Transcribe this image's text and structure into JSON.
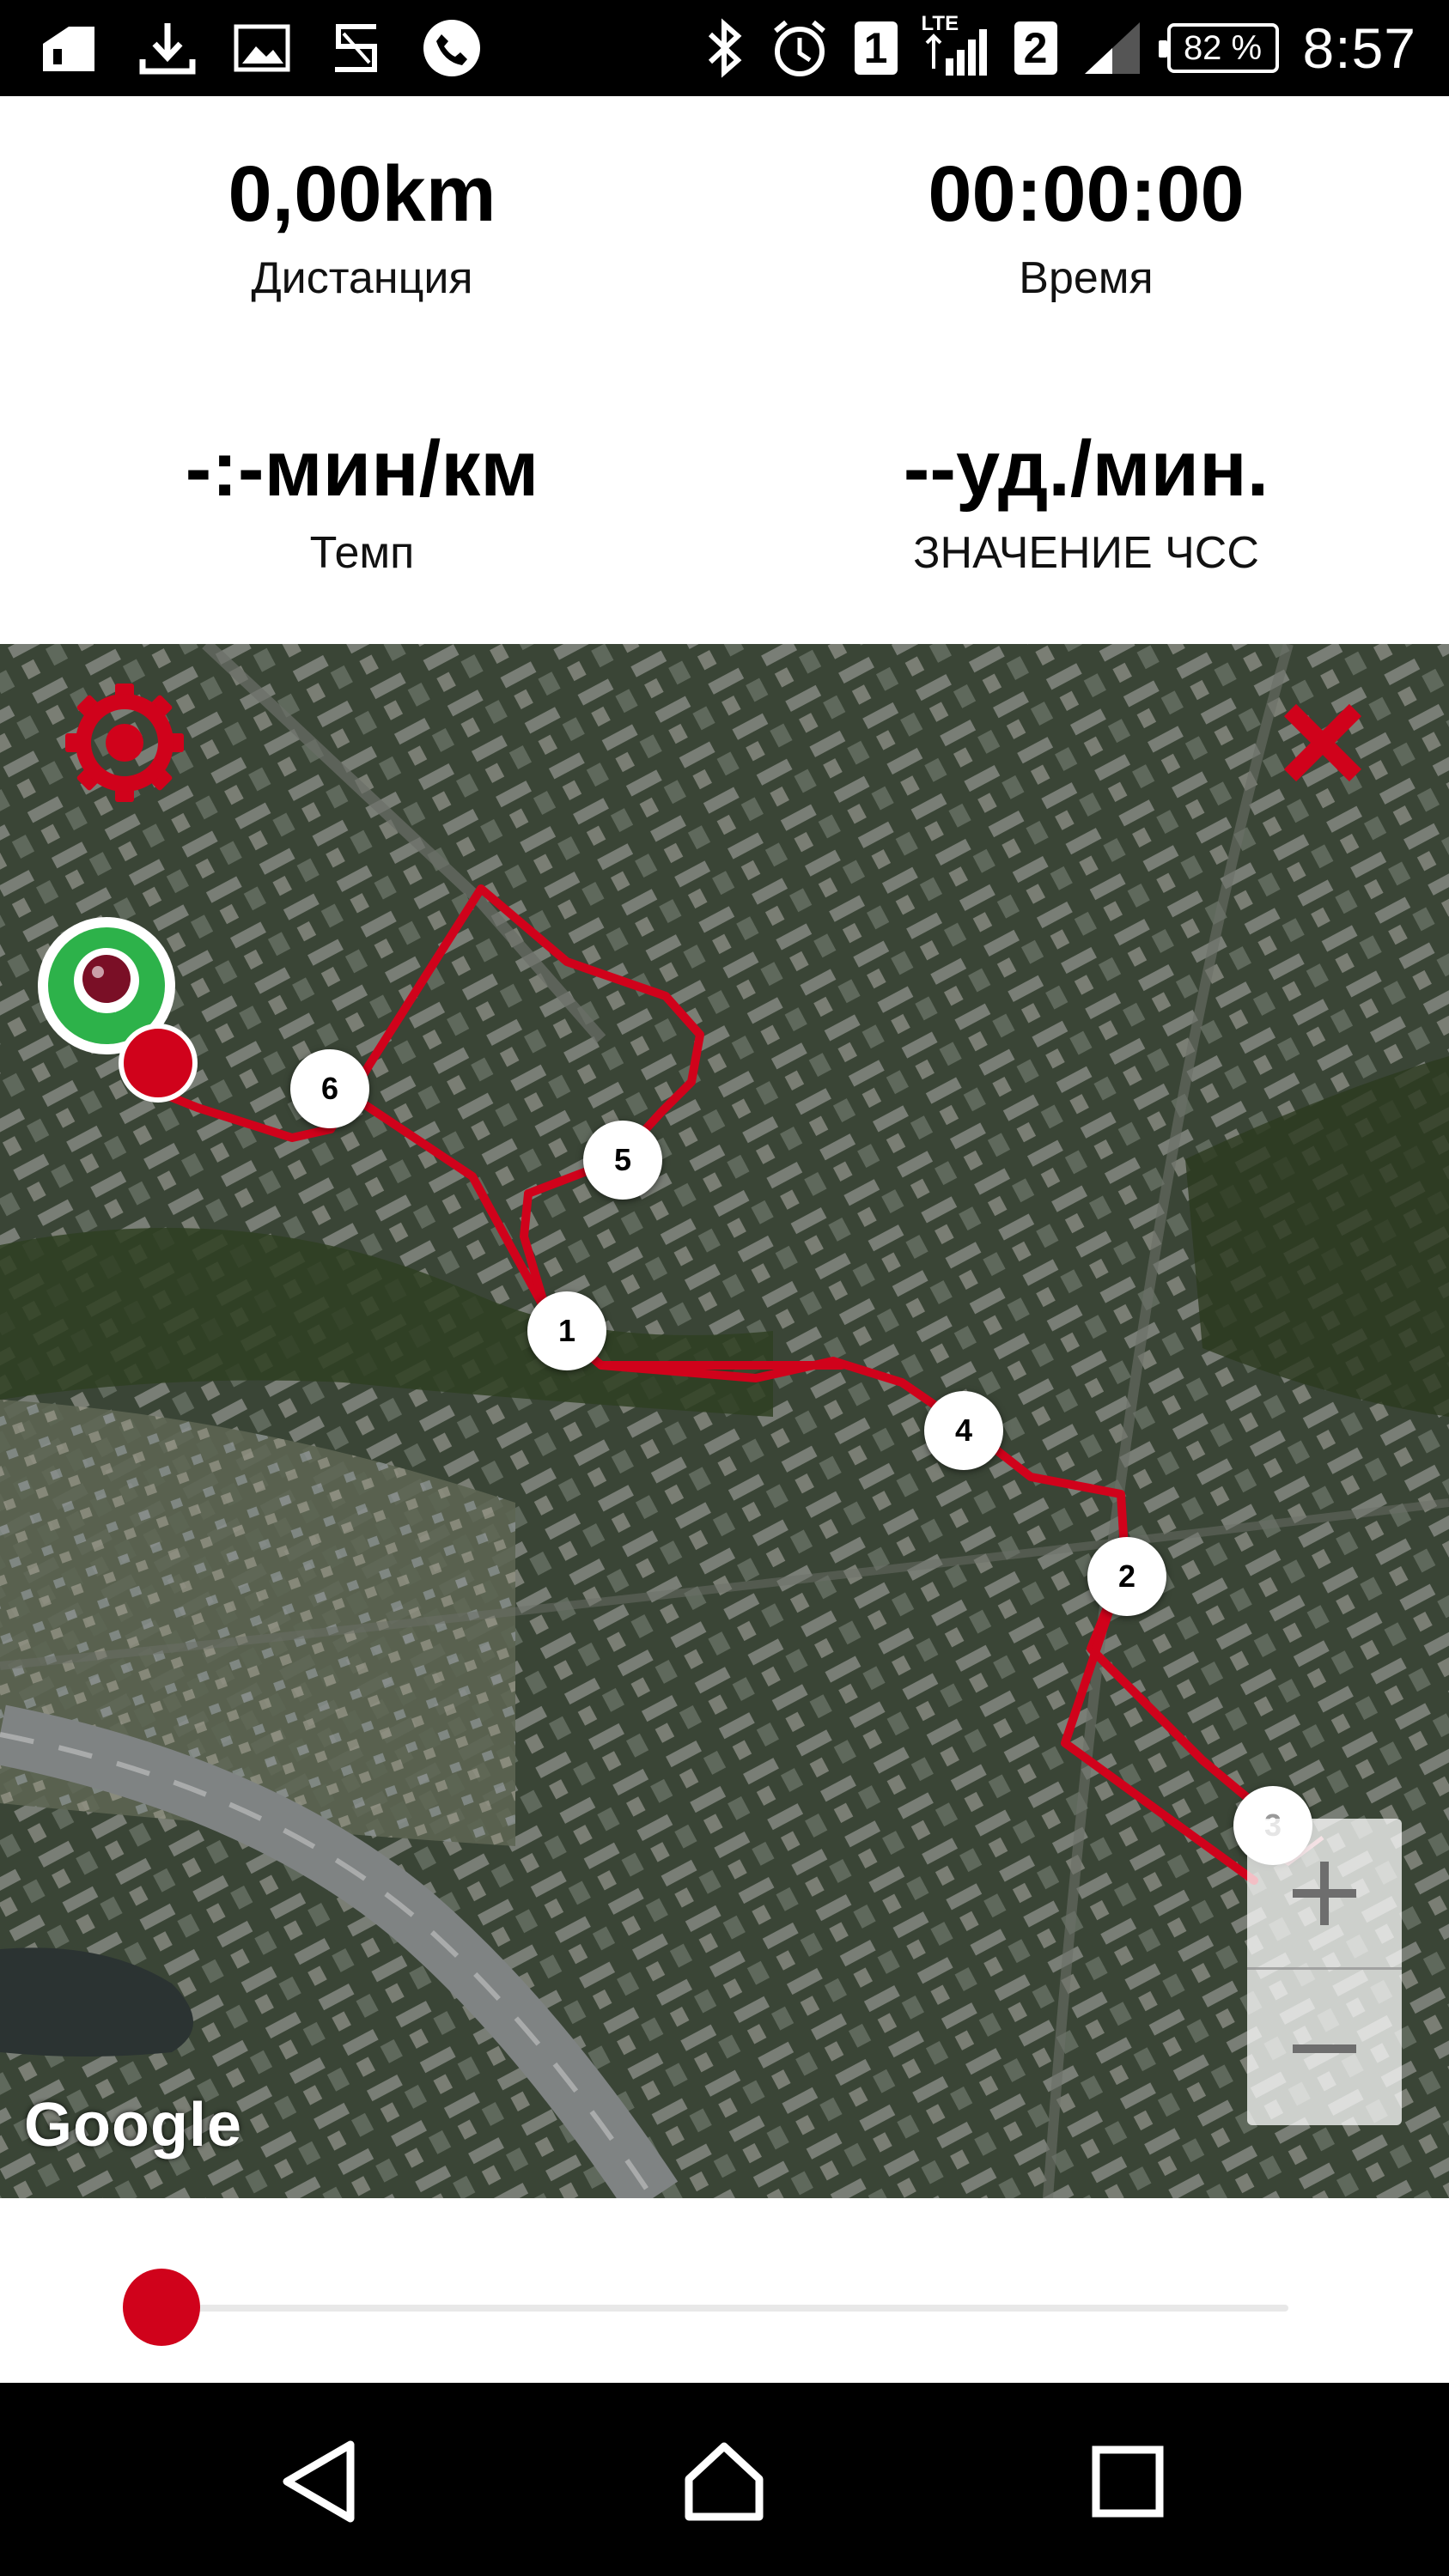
{
  "status_bar": {
    "left_icons": [
      "sim-card-icon",
      "download-icon",
      "image-icon",
      "s-app-icon",
      "phone-call-icon"
    ],
    "right_icons": [
      "bluetooth-icon",
      "alarm-icon",
      "signal-icon",
      "signal-icon"
    ],
    "sim1_label": "1",
    "lte_label": "LTE",
    "sim2_label": "2",
    "battery": "82 %",
    "time": "8:57"
  },
  "stats": {
    "distance": {
      "value": "0,00km",
      "label": "Дистанция"
    },
    "time": {
      "value": "00:00:00",
      "label": "Время"
    },
    "pace": {
      "value": "-:-мин/км",
      "label": "Темп"
    },
    "heart_rate": {
      "value": "--уд./мин.",
      "label": "ЗНАЧЕНИЕ ЧСС"
    }
  },
  "map": {
    "attribution": "Google",
    "markers": [
      "1",
      "2",
      "3",
      "4",
      "5",
      "6"
    ],
    "route_color": "#d0021b",
    "settings_icon": "gear-icon",
    "close_icon": "close-icon",
    "zoom_in_icon": "plus-icon",
    "zoom_out_icon": "minus-icon",
    "start_icon": "location-pin-icon"
  },
  "playback": {
    "progress": 0,
    "accent": "#d0021b"
  },
  "nav_bar": {
    "icons": [
      "back-icon",
      "home-icon",
      "recent-apps-icon"
    ]
  }
}
